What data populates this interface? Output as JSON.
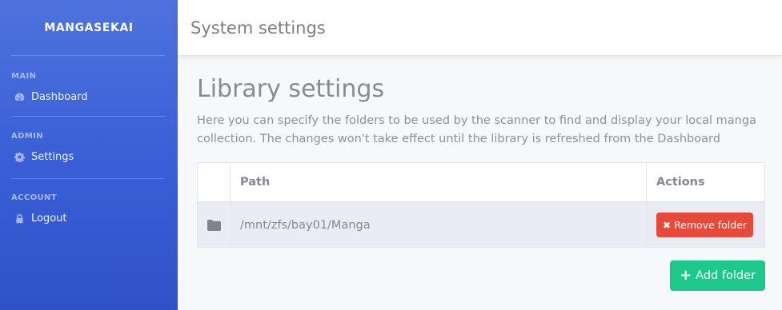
{
  "sidebar": {
    "brand": "MANGASEKAI",
    "sections": [
      {
        "heading": "MAIN",
        "item": {
          "label": "Dashboard",
          "icon": "tachometer-icon"
        }
      },
      {
        "heading": "ADMIN",
        "item": {
          "label": "Settings",
          "icon": "gear-icon"
        }
      },
      {
        "heading": "ACCOUNT",
        "item": {
          "label": "Logout",
          "icon": "lock-icon"
        }
      }
    ]
  },
  "topbar": {
    "title": "System settings"
  },
  "main": {
    "heading": "Library settings",
    "description": "Here you can specify the folders to be used by the scanner to find and display your local manga collection. The changes won't take effect until the library is refreshed from the Dashboard"
  },
  "table": {
    "columns": [
      "",
      "Path",
      "Actions"
    ],
    "rows": [
      {
        "icon": "folder-icon",
        "path": "/mnt/zfs/bay01/Manga",
        "action_label": "Remove folder"
      }
    ]
  },
  "add_button": {
    "label": "Add folder"
  },
  "colors": {
    "sidebar": "#4e73df",
    "danger": "#e74a3b",
    "success": "#1cc88a"
  }
}
